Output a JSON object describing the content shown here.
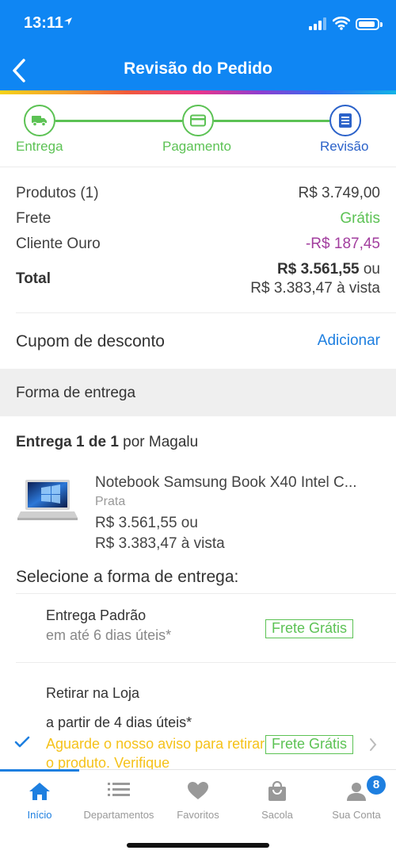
{
  "status_bar": {
    "time": "13:11"
  },
  "header": {
    "title": "Revisão do Pedido"
  },
  "steps": [
    {
      "label": "Entrega",
      "icon": "truck-icon"
    },
    {
      "label": "Pagamento",
      "icon": "card-icon"
    },
    {
      "label": "Revisão",
      "icon": "list-icon"
    }
  ],
  "summary": {
    "products_label": "Produtos (1)",
    "products_value": "R$ 3.749,00",
    "freight_label": "Frete",
    "freight_value": "Grátis",
    "gold_label": "Cliente Ouro",
    "gold_value": "-R$ 187,45",
    "total_label": "Total",
    "total_value": "R$ 3.561,55",
    "total_or": "ou",
    "total_cash": "R$ 3.383,47 à vista"
  },
  "coupon": {
    "label": "Cupom de desconto",
    "action": "Adicionar"
  },
  "delivery_section": {
    "title": "Forma de entrega"
  },
  "delivery": {
    "count": "Entrega 1 de 1",
    "by": " por Magalu"
  },
  "product": {
    "name": "Notebook Samsung Book X40 Intel C...",
    "color": "Prata",
    "price": "R$ 3.561,55 ou",
    "price_cash": "R$ 3.383,47 à vista"
  },
  "select_title": "Selecione a forma de entrega:",
  "options": [
    {
      "title": "Entrega Padrão",
      "subtitle": "em até 6 dias úteis*",
      "badge": "Frete Grátis"
    },
    {
      "title": "Retirar na Loja",
      "subtitle": "a partir de 4 dias úteis*",
      "badge": "Frete Grátis",
      "warning": "Aguarde o nosso aviso para retirar o produto. Verifique"
    }
  ],
  "tabs": [
    {
      "label": "Início",
      "icon": "home-icon"
    },
    {
      "label": "Departamentos",
      "icon": "menu-icon"
    },
    {
      "label": "Favoritos",
      "icon": "heart-icon"
    },
    {
      "label": "Sacola",
      "icon": "bag-icon"
    },
    {
      "label": "Sua Conta",
      "icon": "user-icon"
    }
  ],
  "notifications": "8",
  "colors": {
    "primary": "#0f86f3",
    "success": "#5cc254",
    "discount": "#a23d9e",
    "warning": "#f5c21a",
    "link": "#1e7fe0"
  }
}
